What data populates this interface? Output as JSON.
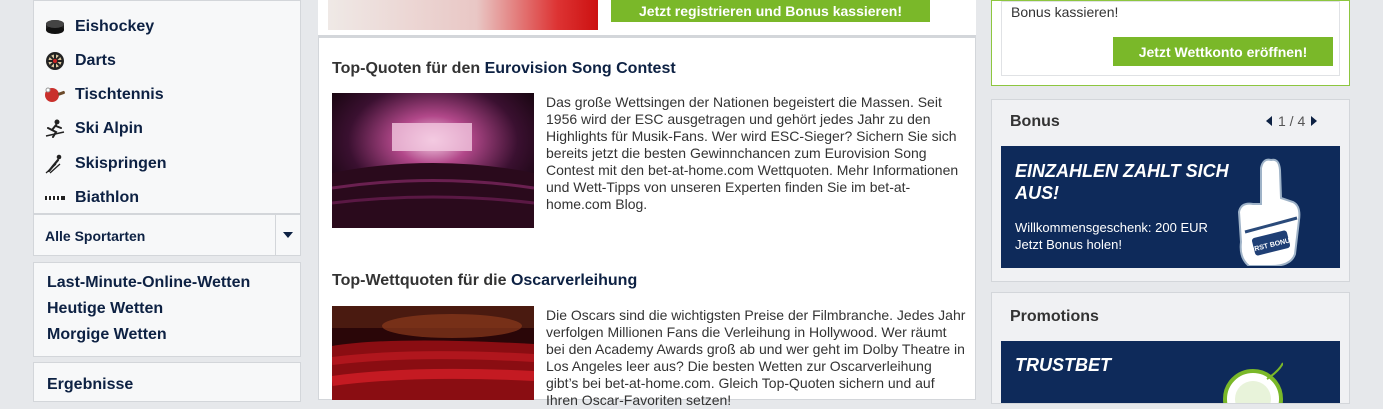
{
  "sports": {
    "items": [
      {
        "label": "Eishockey",
        "icon": "ice-hockey-puck-icon"
      },
      {
        "label": "Darts",
        "icon": "dartboard-icon"
      },
      {
        "label": "Tischtennis",
        "icon": "table-tennis-paddle-icon"
      },
      {
        "label": "Ski Alpin",
        "icon": "ski-alpine-icon"
      },
      {
        "label": "Skispringen",
        "icon": "ski-jumping-icon"
      },
      {
        "label": "Biathlon",
        "icon": "biathlon-rifle-icon"
      }
    ],
    "all_label": "Alle Sportarten"
  },
  "quick_links": [
    "Last-Minute-Online-Wetten",
    "Heutige Wetten",
    "Morgige Wetten"
  ],
  "results_label": "Ergebnisse",
  "center": {
    "register_button": "Jetzt registrieren und Bonus kassieren!",
    "articles": [
      {
        "title_prefix": "Top-Quoten für den ",
        "title_highlight": "Eurovision Song Contest",
        "text": "Das große Wettsingen der Nationen begeistert die Massen. Seit 1956 wird der ESC ausgetragen und gehört jedes Jahr zu den Highlights für Musik-Fans. Wer wird ESC-Sieger? Sichern Sie sich bereits jetzt die besten Gewinnchancen zum Eurovision Song Contest mit den bet-at-home.com Wettquoten. Mehr Informationen und Wett-Tipps von unseren Experten finden Sie im bet-at-home.com Blog."
      },
      {
        "title_prefix": "Top-Wettquoten für die ",
        "title_highlight": "Oscarverleihung",
        "text": "Die Oscars sind die wichtigsten Preise der Filmbranche. Jedes Jahr verfolgen Millionen Fans die Verleihung in Hollywood. Wer räumt bei den Academy Awards groß ab und wer geht im Dolby Theatre in Los Angeles leer aus? Die besten Wetten zur Oscarverleihung gibt’s bei bet-at-home.com. Gleich Top-Quoten sichern und auf Ihren Oscar-Favoriten setzen!"
      }
    ]
  },
  "right": {
    "top_text": "Bonus kassieren!",
    "open_account_button": "Jetzt Wettkonto eröffnen!",
    "bonus": {
      "title": "Bonus",
      "pager": "1 / 4",
      "banner_heading": "EINZAHLEN ZAHLT SICH AUS!",
      "banner_line1": "Willkommensgeschenk: 200 EUR",
      "banner_line2": "Jetzt Bonus holen!",
      "foam_hand_text": "FIRST BONUS"
    },
    "promotions": {
      "title": "Promotions",
      "banner_heading": "TRUSTBET"
    }
  },
  "colors": {
    "accent_green": "#7ab829",
    "navy": "#0d2143",
    "banner_blue": "#0e2a5a"
  }
}
